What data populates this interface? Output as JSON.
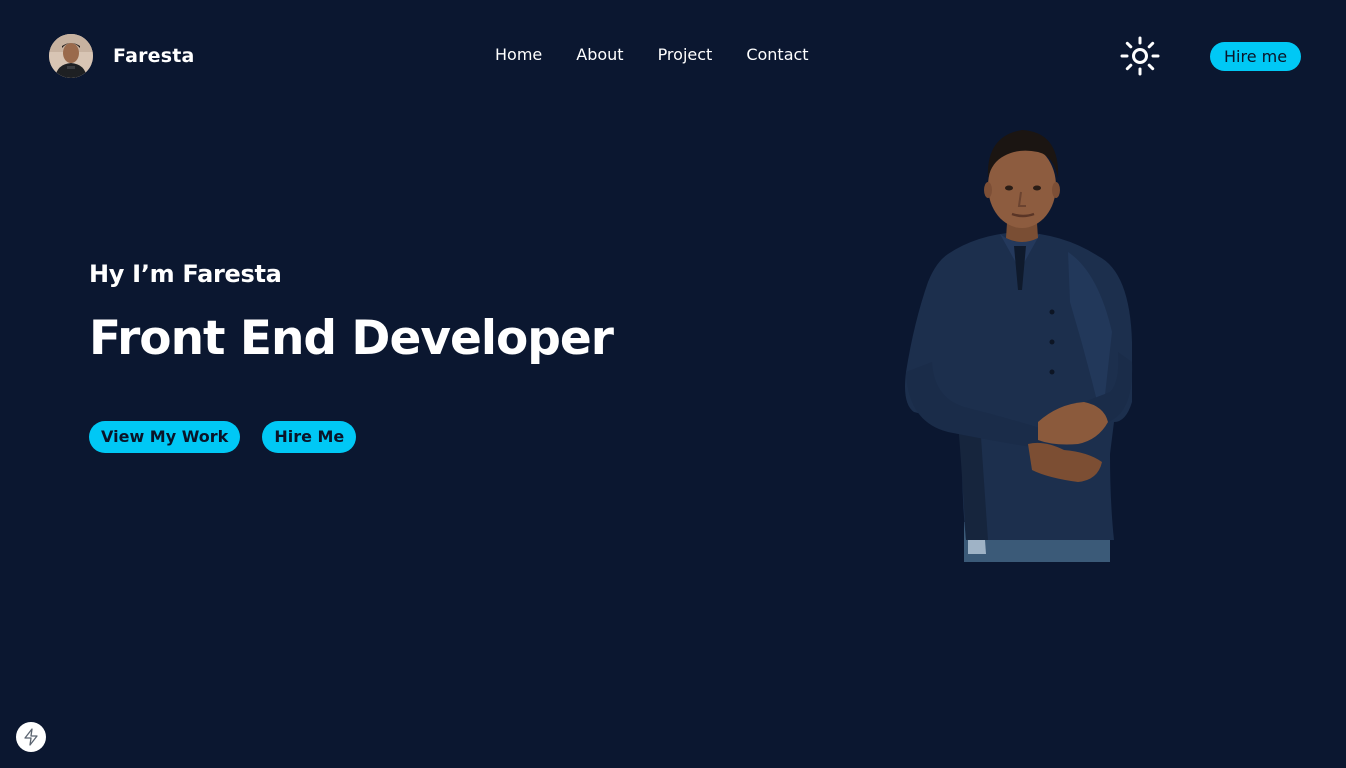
{
  "brand": {
    "name": "Faresta",
    "avatar_icon": "avatar-photo"
  },
  "nav": {
    "items": [
      {
        "label": "Home"
      },
      {
        "label": "About"
      },
      {
        "label": "Project"
      },
      {
        "label": "Contact"
      }
    ],
    "theme_icon": "sun-icon",
    "hire_label": "Hire me"
  },
  "hero": {
    "greeting": "Hy I’m Faresta",
    "title": "Front End Developer",
    "primary_label": "View My Work",
    "secondary_label": "Hire Me",
    "image_icon": "person-portrait"
  },
  "badge": {
    "icon": "lightning-icon"
  },
  "colors": {
    "background": "#0b1730",
    "accent": "#00c8f5",
    "text": "#ffffff",
    "button_text": "#0a1428"
  }
}
